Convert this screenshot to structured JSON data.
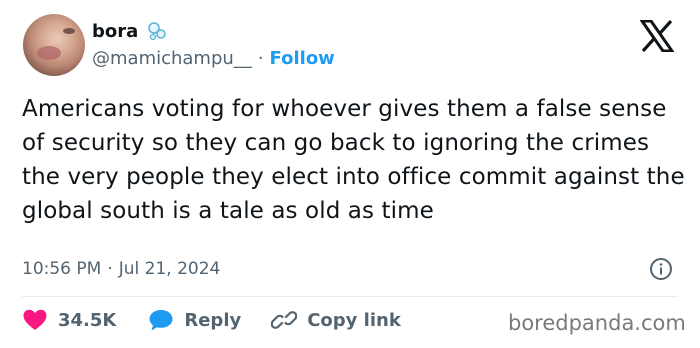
{
  "tweet": {
    "display_name": "bora",
    "handle": "@mamichampu__",
    "separator": "·",
    "follow_label": "Follow",
    "text": "Americans voting for whoever gives them a false sense of security so they can go back to ignoring the crimes the very people they elect into office commit against the global south is a tale as old as time",
    "time": "10:56 PM",
    "meta_separator": "·",
    "date": "Jul 21, 2024"
  },
  "actions": {
    "likes": "34.5K",
    "reply_label": "Reply",
    "copy_link_label": "Copy link"
  },
  "watermark": "boredpanda.com",
  "icons": {
    "name_badge": "soap-bubbles-icon",
    "platform": "x-logo-icon",
    "info": "info-icon",
    "like": "heart-icon",
    "reply": "speech-bubble-icon",
    "copy": "link-icon"
  },
  "colors": {
    "accent": "#1d9bf0",
    "like": "#f91880",
    "text": "#0f1419",
    "secondary": "#536471"
  }
}
